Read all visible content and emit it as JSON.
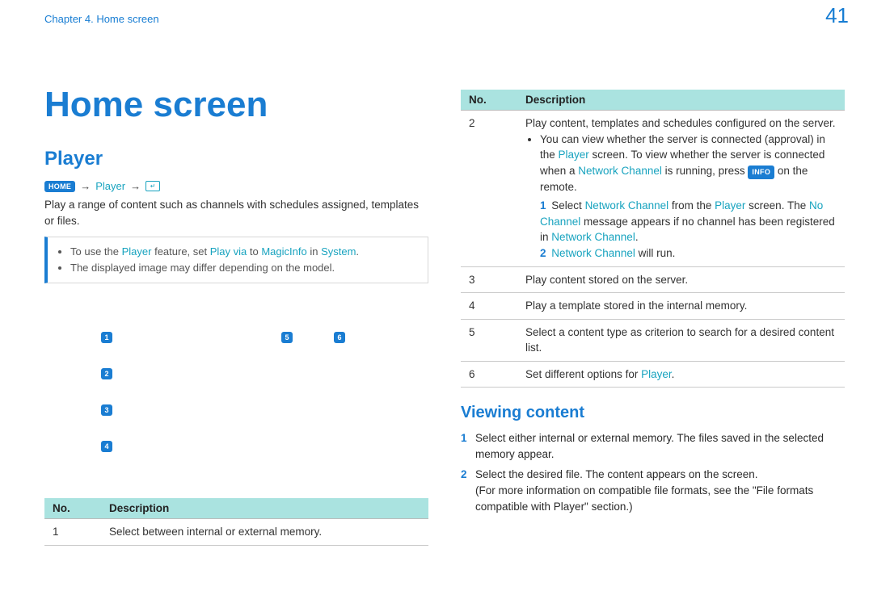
{
  "header": {
    "chapter": "Chapter 4. Home screen",
    "page_number": "41"
  },
  "left": {
    "h1": "Home screen",
    "h2": "Player",
    "nav": {
      "home_kbd": "HOME",
      "arrow": "→",
      "player": "Player"
    },
    "intro": "Play a range of content such as channels with schedules assigned, templates or files.",
    "note": {
      "b1_pre": "To use the ",
      "b1_l1": "Player",
      "b1_mid1": " feature, set ",
      "b1_l2": "Play via",
      "b1_mid2": " to ",
      "b1_l3": "MagicInfo",
      "b1_mid3": " in ",
      "b1_l4": "System",
      "b1_post": ".",
      "b2": "The displayed image may differ depending on the model."
    },
    "callouts": {
      "c1": "1",
      "c2": "2",
      "c3": "3",
      "c4": "4",
      "c5": "5",
      "c6": "6"
    },
    "table": {
      "th_no": "No.",
      "th_desc": "Description",
      "r1_no": "1",
      "r1_desc": "Select between internal or external memory."
    }
  },
  "right": {
    "table": {
      "th_no": "No.",
      "th_desc": "Description",
      "r2_no": "2",
      "r3_no": "3",
      "r4_no": "4",
      "r5_no": "5",
      "r6_no": "6"
    },
    "r2": {
      "line1": "Play content, templates and schedules configured on the server.",
      "b1_pre": "You can view whether the server is connected (approval) in the ",
      "b1_l1": "Player",
      "b1_mid1": " screen. To view whether the server is connected when a ",
      "b1_l2": "Network Channel",
      "b1_mid2": " is running, press ",
      "b1_kbd": "INFO",
      "b1_post": " on the remote.",
      "s1_num": "1",
      "s1_pre": "Select ",
      "s1_l1": "Network Channel",
      "s1_mid1": " from the ",
      "s1_l2": "Player",
      "s1_mid2": " screen. The ",
      "s1_l3": "No Channel",
      "s1_mid3": " message appears if no channel has been registered in ",
      "s1_l4": "Network Channel",
      "s1_post": ".",
      "s2_num": "2",
      "s2_l1": "Network Channel",
      "s2_post": " will run."
    },
    "r3": "Play content stored on the server.",
    "r4": "Play a template stored in the internal memory.",
    "r5": "Select a content type as criterion to search for a desired content list.",
    "r6_pre": "Set different options for ",
    "r6_l1": "Player",
    "r6_post": ".",
    "viewing": {
      "heading": "Viewing content",
      "s1_num": "1",
      "s1": "Select either internal or external memory. The files saved in the selected memory appear.",
      "s2_num": "2",
      "s2a": "Select the desired file. The content appears on the screen.",
      "s2b": "(For more information on compatible file formats, see the \"File formats compatible with Player\" section.)"
    }
  }
}
